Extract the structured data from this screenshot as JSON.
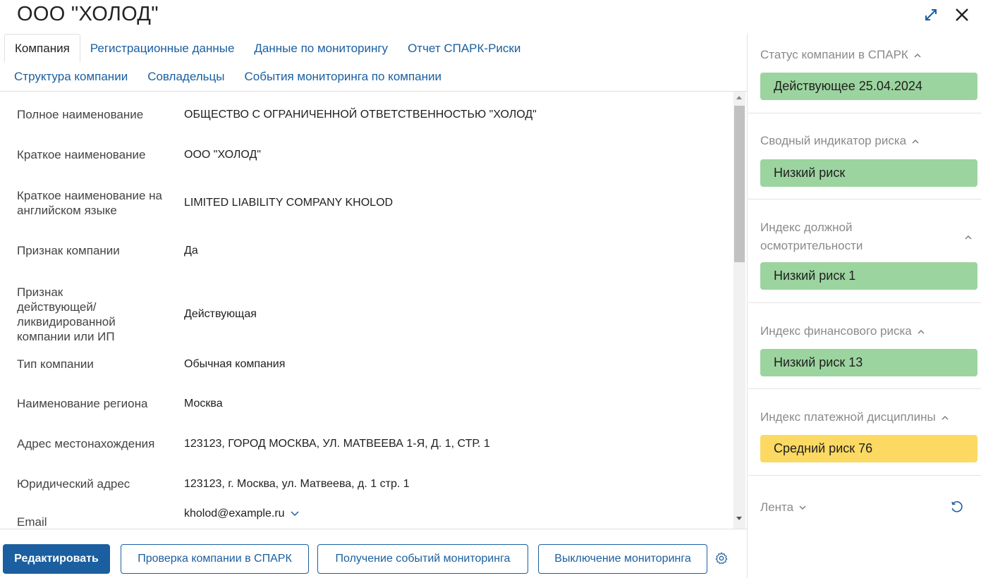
{
  "header": {
    "title": "ООО \"ХОЛОД\""
  },
  "tabs": [
    {
      "label": "Компания",
      "active": true
    },
    {
      "label": "Регистрационные данные",
      "active": false
    },
    {
      "label": "Данные по мониторингу",
      "active": false
    },
    {
      "label": "Отчет СПАРК-Риски",
      "active": false
    },
    {
      "label": "Структура компании",
      "active": false
    },
    {
      "label": "Совладельцы",
      "active": false
    },
    {
      "label": "События мониторинга по компании",
      "active": false
    }
  ],
  "fields": [
    {
      "label": "Полное наименование",
      "value": "ОБЩЕСТВО С ОГРАНИЧЕННОЙ ОТВЕТСТВЕННОСТЬЮ \"ХОЛОД\""
    },
    {
      "label": "Краткое наименование",
      "value": "ООО \"ХОЛОД\""
    },
    {
      "label": "Краткое наименование на английском языке",
      "value": "LIMITED LIABILITY COMPANY KHOLOD"
    },
    {
      "label": "Признак компании",
      "value": "Да"
    },
    {
      "label": "Признак действующей/ ликвидированной компании или ИП",
      "value": "Действующая"
    },
    {
      "label": "Тип компании",
      "value": "Обычная компания"
    },
    {
      "label": "Наименование региона",
      "value": "Москва"
    },
    {
      "label": "Адрес местонахождения",
      "value": "123123, ГОРОД МОСКВА, УЛ. МАТВЕЕВА 1-Я, Д. 1, СТР. 1"
    },
    {
      "label": "Юридический адрес",
      "value": "123123, г. Москва, ул. Матвеева, д. 1 стр. 1"
    },
    {
      "label": "Email",
      "value": "kholod@example.ru"
    }
  ],
  "footer": {
    "edit_label": "Редактировать",
    "check_label": "Проверка компании в СПАРК",
    "events_label": "Получение событий мониторинга",
    "disable_label": "Выключение мониторинга"
  },
  "sidebar": {
    "sections": [
      {
        "title": "Статус компании в СПАРК",
        "value": "Действующее 25.04.2024",
        "color": "#9cd49f"
      },
      {
        "title": "Сводный индикатор риска",
        "value": "Низкий риск",
        "color": "#9cd49f"
      },
      {
        "title": "Индекс должной осмотрительности",
        "value": "Низкий риск 1",
        "color": "#9cd49f"
      },
      {
        "title": "Индекс финансового риска",
        "value": "Низкий риск 13",
        "color": "#9cd49f"
      },
      {
        "title": "Индекс платежной дисциплины",
        "value": "Средний риск 76",
        "color": "#fcd963"
      }
    ],
    "feed_label": "Лента"
  }
}
